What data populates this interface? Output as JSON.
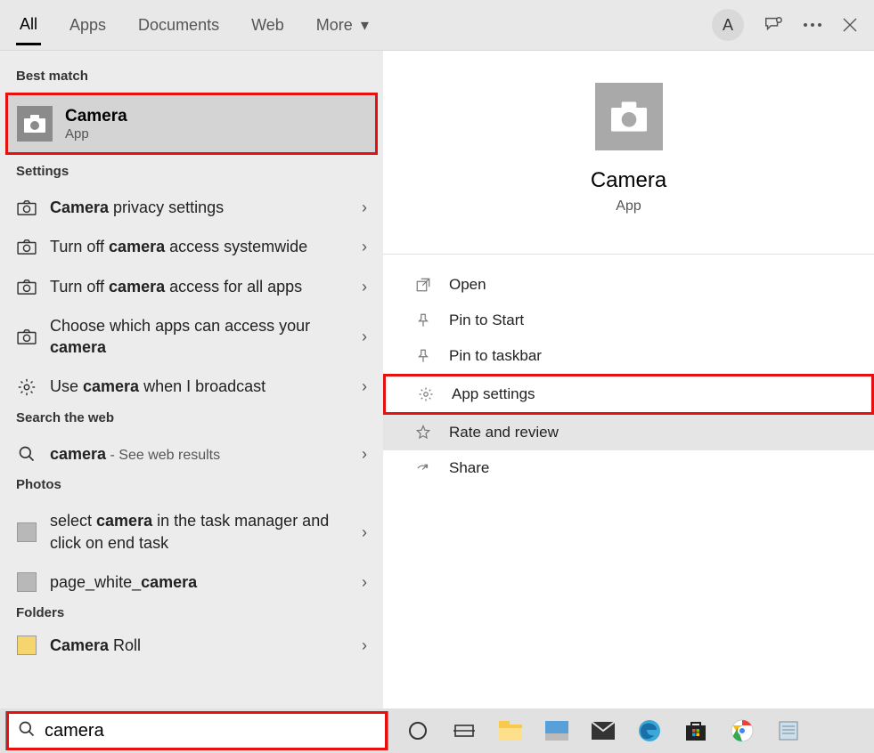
{
  "tabs": {
    "all": "All",
    "apps": "Apps",
    "documents": "Documents",
    "web": "Web",
    "more": "More"
  },
  "user": {
    "initial": "A"
  },
  "sections": {
    "bestmatch": "Best match",
    "settings": "Settings",
    "searchweb": "Search the web",
    "photos": "Photos",
    "folders": "Folders"
  },
  "bestmatch": {
    "title": "Camera",
    "subtitle": "App"
  },
  "settings_items": [
    {
      "prefix": "",
      "bold": "Camera",
      "suffix": " privacy settings"
    },
    {
      "prefix": "Turn off ",
      "bold": "camera",
      "suffix": " access systemwide"
    },
    {
      "prefix": "Turn off ",
      "bold": "camera",
      "suffix": " access for all apps"
    },
    {
      "prefix": "Choose which apps can access your ",
      "bold": "camera",
      "suffix": ""
    },
    {
      "prefix": "Use ",
      "bold": "camera",
      "suffix": " when I broadcast"
    }
  ],
  "webitem": {
    "bold": "camera",
    "suffix": " - See web results"
  },
  "photos": [
    {
      "prefix": "select ",
      "bold": "camera",
      "suffix": " in the task manager and click on end task"
    },
    {
      "prefix": "page_white_",
      "bold": "camera",
      "suffix": ""
    }
  ],
  "folders": [
    {
      "bold": "Camera",
      "suffix": " Roll"
    }
  ],
  "preview": {
    "title": "Camera",
    "subtitle": "App"
  },
  "actions": {
    "open": "Open",
    "pin_start": "Pin to Start",
    "pin_taskbar": "Pin to taskbar",
    "app_settings": "App settings",
    "rate": "Rate and review",
    "share": "Share"
  },
  "search": {
    "value": "camera"
  }
}
